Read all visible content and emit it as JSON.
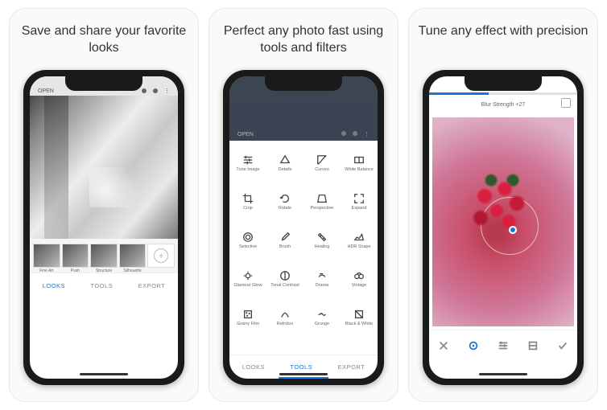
{
  "panels": [
    {
      "headline": "Save and share your favorite looks"
    },
    {
      "headline": "Perfect any photo fast using tools and filters"
    },
    {
      "headline": "Tune any effect with precision"
    }
  ],
  "screen1": {
    "open_label": "OPEN",
    "thumbs": [
      "Fine Art",
      "Push",
      "Structure",
      "Silhouette"
    ],
    "tabs": {
      "looks": "LOOKS",
      "tools": "TOOLS",
      "export": "EXPORT"
    }
  },
  "screen2": {
    "open_label": "OPEN",
    "tools": [
      "Tune Image",
      "Details",
      "Curves",
      "White Balance",
      "Crop",
      "Rotate",
      "Perspective",
      "Expand",
      "Selective",
      "Brush",
      "Healing",
      "HDR Scape",
      "Glamour Glow",
      "Tonal Contrast",
      "Drama",
      "Vintage",
      "Grainy Film",
      "Retrolux",
      "Grunge",
      "Black & White"
    ],
    "tabs": {
      "looks": "LOOKS",
      "tools": "TOOLS",
      "export": "EXPORT"
    }
  },
  "screen3": {
    "title": "Blur Strength +27",
    "progress_pct": 40
  }
}
